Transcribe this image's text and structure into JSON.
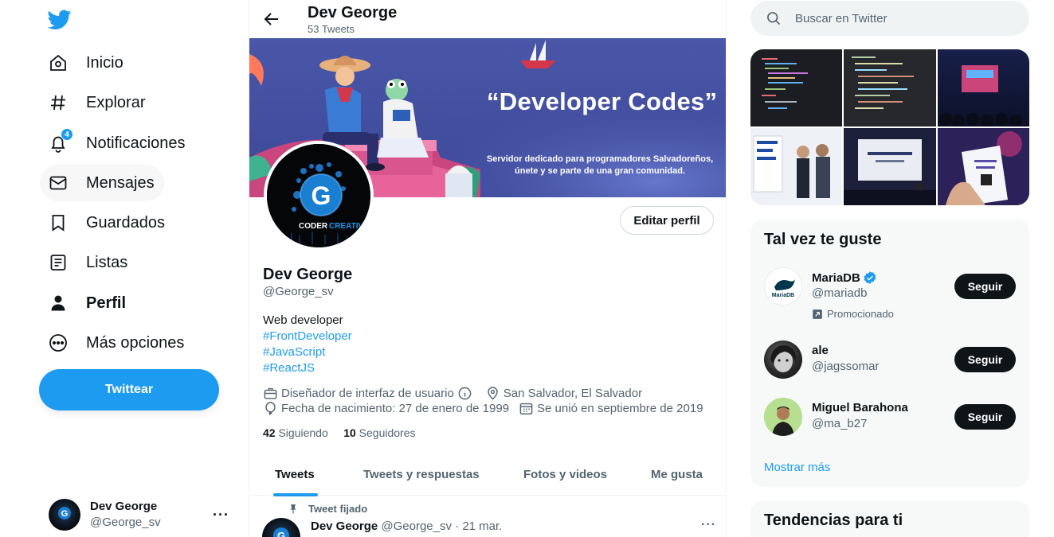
{
  "colors": {
    "accent": "#1d9bf0",
    "text": "#0f1419",
    "muted": "#536471",
    "follow_bg": "#0f1419"
  },
  "sidebar": {
    "logo_icon": "twitter-bird-icon",
    "items": [
      {
        "label": "Inicio",
        "icon": "home-icon"
      },
      {
        "label": "Explorar",
        "icon": "hashtag-icon"
      },
      {
        "label": "Notificaciones",
        "icon": "bell-icon",
        "badge": "4"
      },
      {
        "label": "Mensajes",
        "icon": "envelope-icon"
      },
      {
        "label": "Guardados",
        "icon": "bookmark-icon"
      },
      {
        "label": "Listas",
        "icon": "list-icon"
      },
      {
        "label": "Perfil",
        "icon": "person-icon"
      },
      {
        "label": "Más opciones",
        "icon": "more-circle-icon"
      }
    ],
    "tweet_button": "Twittear",
    "account": {
      "name": "Dev George",
      "handle": "@George_sv",
      "more": "···"
    }
  },
  "header": {
    "name": "Dev George",
    "tweet_count": "53 Tweets"
  },
  "banner": {
    "title": "“Developer Codes”",
    "subtitle_line1": "Servidor dedicado para programadores Salvadoreños,",
    "subtitle_line2": "únete y se parte de una gran comunidad."
  },
  "avatar": {
    "letter": "G",
    "caption_1": "CODER",
    "caption_2": "CREATIVE"
  },
  "profile": {
    "edit_button": "Editar perfil",
    "name": "Dev George",
    "handle": "@George_sv",
    "bio": "Web developer",
    "tags": [
      "#FrontDeveloper",
      "#JavaScript",
      "#ReactJS"
    ],
    "category": "Diseñador de interfaz de usuario",
    "location": "San Salvador, El Salvador",
    "birthday": "Fecha de nacimiento: 27 de enero de 1999",
    "joined": "Se unió en septiembre de 2019",
    "following_count": "42",
    "following_label": "Siguiendo",
    "followers_count": "10",
    "followers_label": "Seguidores"
  },
  "tabs": [
    "Tweets",
    "Tweets y respuestas",
    "Fotos y videos",
    "Me gusta"
  ],
  "pinned_tweet": {
    "label": "Tweet fijado",
    "name": "Dev George",
    "handle": "@George_sv",
    "date": "· 21 mar.",
    "more": "···"
  },
  "search": {
    "placeholder": "Buscar en Twitter"
  },
  "suggestions": {
    "title": "Tal vez te guste",
    "follow_label": "Seguir",
    "users": [
      {
        "name": "MariaDB",
        "handle": "@mariadb",
        "verified": true,
        "promoted": "Promocionado",
        "avatar_text": "MariaDB"
      },
      {
        "name": "ale",
        "handle": "@jagssomar"
      },
      {
        "name": "Miguel Barahona",
        "handle": "@ma_b27"
      }
    ],
    "show_more": "Mostrar más"
  },
  "trends": {
    "title": "Tendencias para ti"
  }
}
